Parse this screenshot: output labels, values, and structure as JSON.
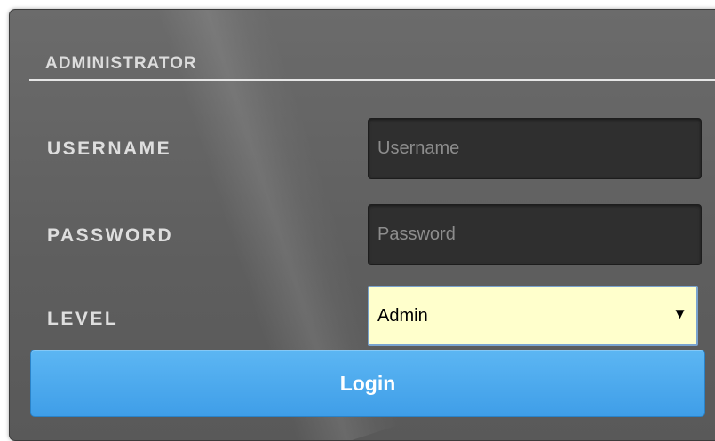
{
  "form": {
    "section_title": "ADMINISTRATOR",
    "username": {
      "label": "USERNAME",
      "value": "",
      "placeholder": "Username"
    },
    "password": {
      "label": "PASSWORD",
      "value": "",
      "placeholder": "Password"
    },
    "level": {
      "label": "LEVEL",
      "selected": "Admin",
      "arrow_glyph": "▼"
    },
    "login_label": "Login"
  },
  "colors": {
    "panel_background": "#5e5e5e",
    "input_background": "#2f2f2f",
    "select_background": "#ffffcc",
    "button_background": "#3f9ee8",
    "label_text": "#dedede"
  },
  "icons": {
    "level_select_arrow": "chevron-down-icon"
  }
}
